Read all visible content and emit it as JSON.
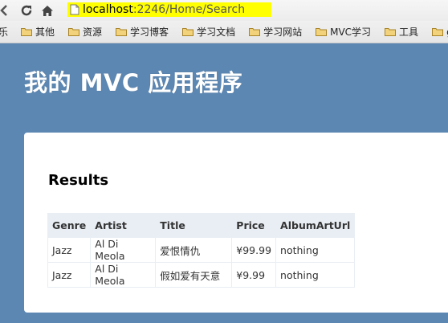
{
  "browser": {
    "url_host": "localhost",
    "url_rest": ":2246/Home/Search"
  },
  "bookmarks": {
    "items": [
      {
        "label": "乐"
      },
      {
        "label": "其他"
      },
      {
        "label": "资源"
      },
      {
        "label": "学习博客"
      },
      {
        "label": "学习文档"
      },
      {
        "label": "学习网站"
      },
      {
        "label": "MVC学习"
      },
      {
        "label": "工具"
      },
      {
        "label": "go"
      }
    ]
  },
  "header": {
    "site_title": "我的 MVC 应用程序"
  },
  "main": {
    "results_title": "Results",
    "table": {
      "headers": [
        "Genre",
        "Artist",
        "Title",
        "Price",
        "AlbumArtUrl"
      ],
      "rows": [
        [
          "Jazz",
          "Al Di Meola",
          "爱恨情仇",
          "¥99.99",
          "nothing"
        ],
        [
          "Jazz",
          "Al Di Meola",
          "假如爱有天意",
          "¥9.99",
          "nothing"
        ]
      ]
    }
  },
  "colors": {
    "page_background": "#5c87b2",
    "address_highlight": "#ffff00",
    "table_header_bg": "#e8eef4",
    "folder_icon": "#e8c05a"
  }
}
